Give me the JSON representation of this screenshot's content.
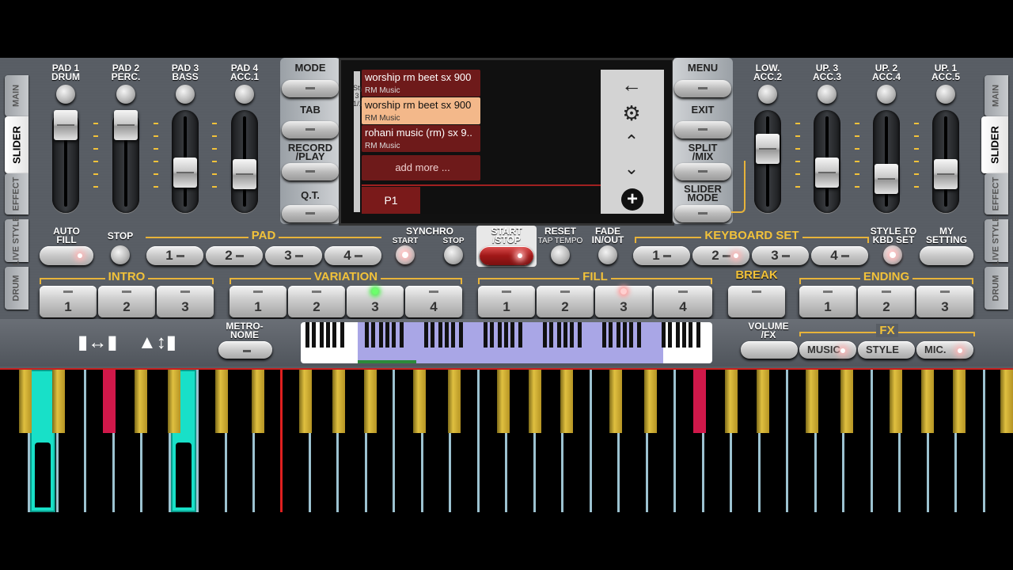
{
  "pads_left": [
    {
      "label": "PAD 1\nDRUM",
      "level": "high"
    },
    {
      "label": "PAD 2\nPERC.",
      "level": "high"
    },
    {
      "label": "PAD 3\nBASS",
      "level": "mid"
    },
    {
      "label": "PAD 4\nACC.1",
      "level": "mid"
    }
  ],
  "pads_right": [
    {
      "label": "LOW.\nACC.2"
    },
    {
      "label": "UP. 3\nACC.3"
    },
    {
      "label": "UP. 2\nACC.4"
    },
    {
      "label": "UP. 1\nACC.5"
    }
  ],
  "left_tabs": [
    "MAIN",
    "SLIDER",
    "EFFECT",
    "LIVE STYLE",
    "DRUM"
  ],
  "right_tabs": [
    "MAIN",
    "SLIDER",
    "EFFECT",
    "LIVE STYLE",
    "DRUM"
  ],
  "mid_left_buttons": [
    "MODE",
    "TAB",
    "RECORD\n/PLAY",
    "Q.T."
  ],
  "mid_right_buttons": [
    "MENU",
    "EXIT",
    "SPLIT\n/MIX",
    "SLIDER\nMODE"
  ],
  "screen": {
    "side_label": "Style\n3\n1/1",
    "items": [
      {
        "title": "worship rm beet sx 900",
        "subtitle": "RM Music",
        "selected": false
      },
      {
        "title": "worship rm beet sx 900",
        "subtitle": "RM Music",
        "selected": true
      },
      {
        "title": "rohani music (rm) sx 9..",
        "subtitle": "RM Music",
        "selected": false
      }
    ],
    "add_more": "add more ...",
    "page_tab": "P1",
    "icons": [
      "back-arrow-icon",
      "gear-icon",
      "chevron-up-icon",
      "chevron-down-icon",
      "add-circle-icon"
    ]
  },
  "controls": {
    "auto_fill": "AUTO\nFILL",
    "stop": "STOP",
    "pad": "PAD",
    "pad_buttons": [
      "1",
      "2",
      "3",
      "4"
    ],
    "synchro": "SYNCHRO",
    "synchro_start": "START",
    "synchro_stop": "STOP",
    "start_stop": "START\n/STOP",
    "reset": "RESET",
    "tap_tempo": "TAP TEMPO",
    "fade": "FADE\nIN/OUT",
    "keyboard_set": "KEYBOARD SET",
    "kbd_buttons": [
      "1",
      "2",
      "3",
      "4"
    ],
    "style_to_kbd": "STYLE TO\nKBD SET",
    "my_setting": "MY\nSETTING"
  },
  "sections": {
    "intro": {
      "label": "INTRO",
      "buttons": [
        "1",
        "2",
        "3"
      ]
    },
    "variation": {
      "label": "VARIATION",
      "buttons": [
        "1",
        "2",
        "3",
        "4"
      ],
      "active": "3"
    },
    "fill": {
      "label": "FILL",
      "buttons": [
        "1",
        "2",
        "3",
        "4"
      ]
    },
    "break": {
      "label": "BREAK"
    },
    "ending": {
      "label": "ENDING",
      "buttons": [
        "1",
        "2",
        "3"
      ]
    }
  },
  "bottom": {
    "metronome": "METRO-\nNOME",
    "volume": "VOLUME\n/FX",
    "fx": "FX",
    "fx_buttons": [
      "MUSIC",
      "STYLE",
      "MIC."
    ]
  },
  "colors": {
    "accent": "#f2c23a",
    "led_green": "#4cf04c",
    "screen_red": "#6e1a1a",
    "selected": "#f3b88a",
    "key_cyan": "#18e0c8",
    "key_red": "#d0184a"
  }
}
